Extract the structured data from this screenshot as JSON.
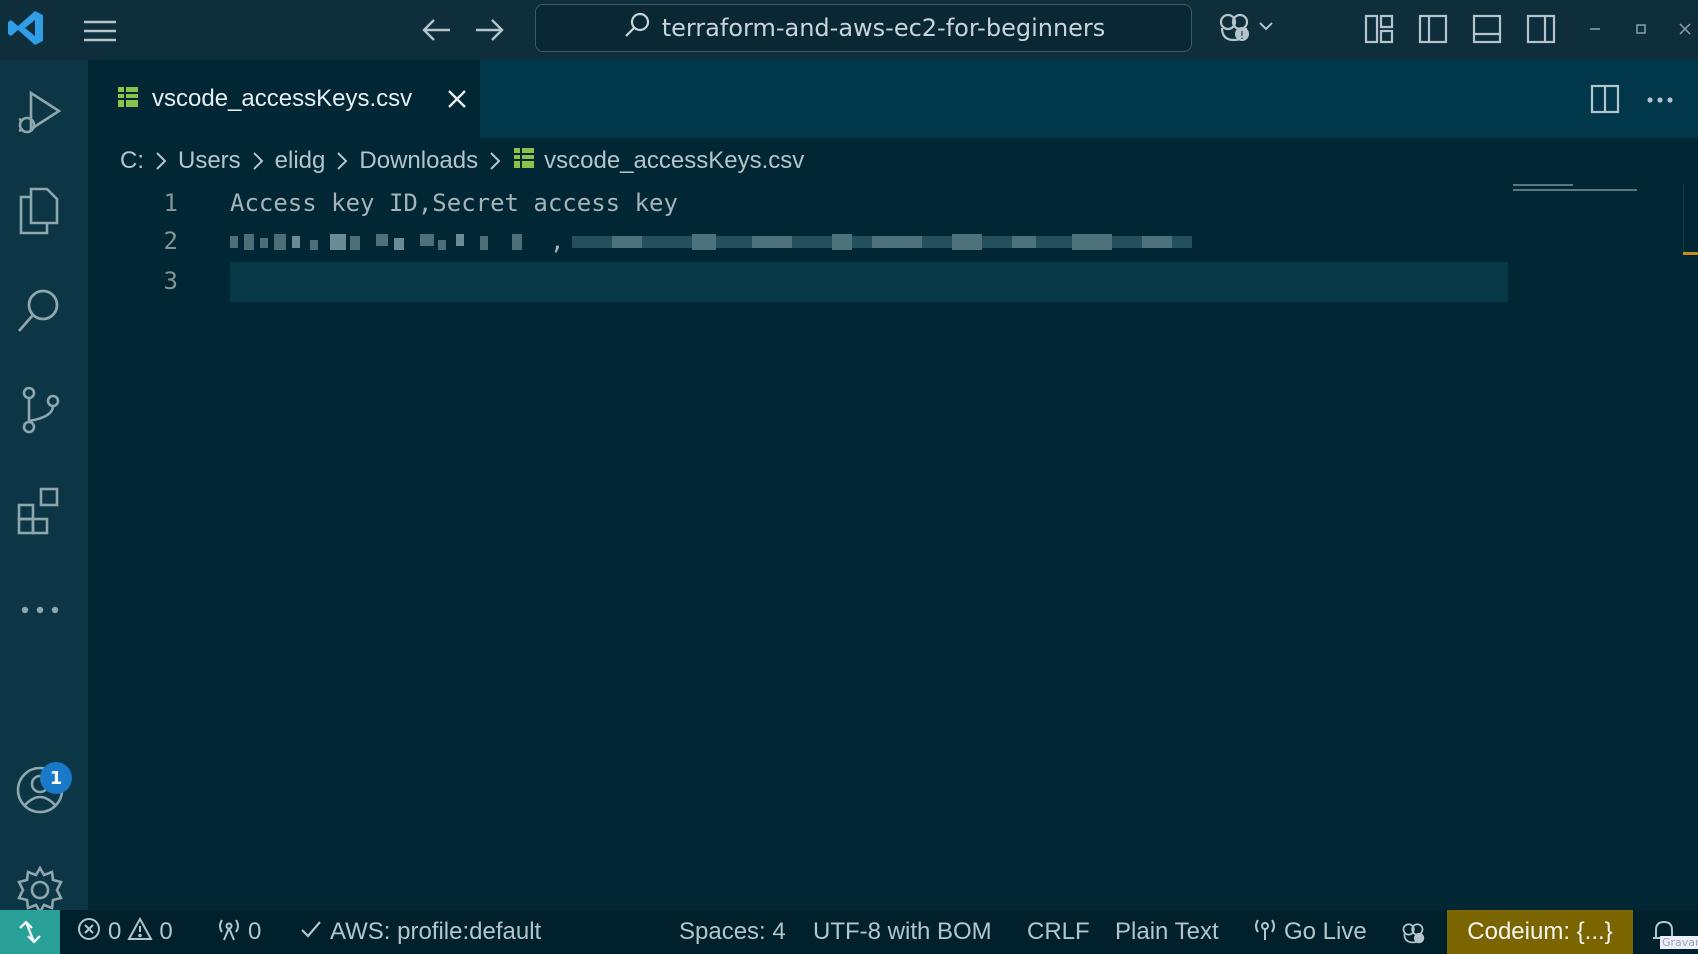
{
  "window": {
    "search_text": "terraform-and-aws-ec2-for-beginners"
  },
  "editor": {
    "tab_label": "vscode_accessKeys.csv",
    "breadcrumbs": [
      "C:",
      "Users",
      "elidg",
      "Downloads",
      "vscode_accessKeys.csv"
    ],
    "lines": [
      {
        "num": "1",
        "text": "Access key ID,Secret access key"
      },
      {
        "num": "2",
        "text": ","
      },
      {
        "num": "3",
        "text": ""
      }
    ]
  },
  "activity": {
    "accounts_badge": "1"
  },
  "status": {
    "errors": "0",
    "warnings": "0",
    "ports": "0",
    "aws_profile": "AWS: profile:default",
    "spaces": "Spaces: 4",
    "encoding": "UTF-8 with BOM",
    "eol": "CRLF",
    "language": "Plain Text",
    "go_live": "Go Live",
    "codeium": "Codeium: {...}",
    "gravar": "Gravar"
  },
  "colors": {
    "accent_teal": "#2aa198",
    "codeium_bg": "#7b6500",
    "badge_blue": "#1779c8",
    "editor_bg": "#002733"
  }
}
